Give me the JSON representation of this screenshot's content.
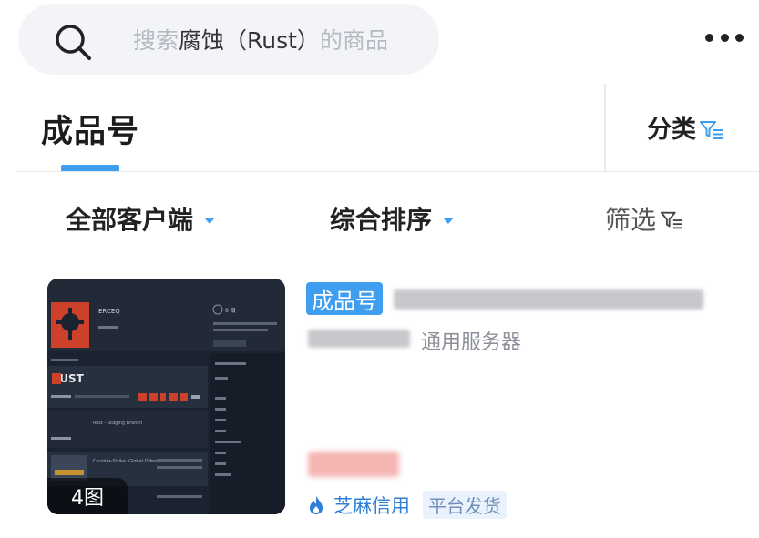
{
  "search": {
    "placeholder_prefix": "搜索",
    "keyword": "腐蚀（Rust）",
    "placeholder_suffix": "的商品"
  },
  "icons": {
    "search": "search-icon",
    "more": "more-icon",
    "filter": "funnel-icon",
    "flame": "flame-icon"
  },
  "tabs": {
    "active": "成品号",
    "category_label": "分类"
  },
  "filters": {
    "client": "全部客户端",
    "sort": "综合排序",
    "filter": "筛选"
  },
  "product": {
    "tag": "成品号",
    "server": "通用服务器",
    "image_count": "4图",
    "credit": "芝麻信用",
    "shipping": "平台发货",
    "thumbnail": {
      "username": "ERCEQ",
      "game_logo": "RUST",
      "level": "0 级",
      "game2": "Rust - Staging Branch",
      "game3": "Counter-Strike: Global Offensive"
    }
  },
  "colors": {
    "accent": "#3f9ef0",
    "credit_blue": "#2e7fd8",
    "price_red": "#e85b55"
  }
}
